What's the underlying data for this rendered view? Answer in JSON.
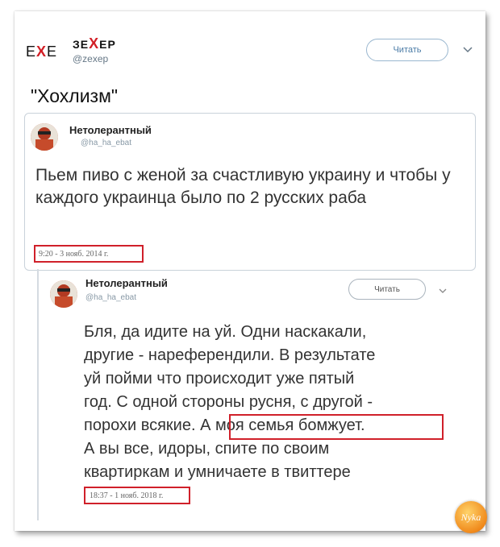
{
  "account": {
    "logo_text": [
      "E",
      "X",
      "E"
    ],
    "name_parts": [
      "ЗЕ",
      "X",
      "ЕР"
    ],
    "handle": "@zexep",
    "follow_label": "Читать"
  },
  "tweet": {
    "text": "\"Хохлизм\""
  },
  "quoted_1": {
    "author": "Нетолерантный",
    "handle": "@ha_ha_ebat",
    "text": "Пьем пиво с женой за счастливую украину и чтобы у каждого украинца было по 2 русских раба",
    "date": "9:20 - 3 нояб. 2014 г."
  },
  "quoted_2": {
    "author": "Нетолерантный",
    "handle": "@ha_ha_ebat",
    "follow_label": "Читать",
    "text_lines": [
      "Бля, да идите на   уй. Одни наскакали,",
      "другие - нареферендили. В результате",
      "  уй пойми что происходит уже пятый",
      "год. С одной стороны русня, с другой -",
      "порохи всякие. А моя семья бомжует.",
      "А вы все,   идоры, спите по своим",
      "квартиркам и умничаете в твиттере"
    ],
    "date": "18:37 - 1 нояб. 2018 г."
  },
  "watermark": "Nyka",
  "colors": {
    "accent_red": "#d0202a",
    "follow_blue": "#4a7ba6"
  }
}
